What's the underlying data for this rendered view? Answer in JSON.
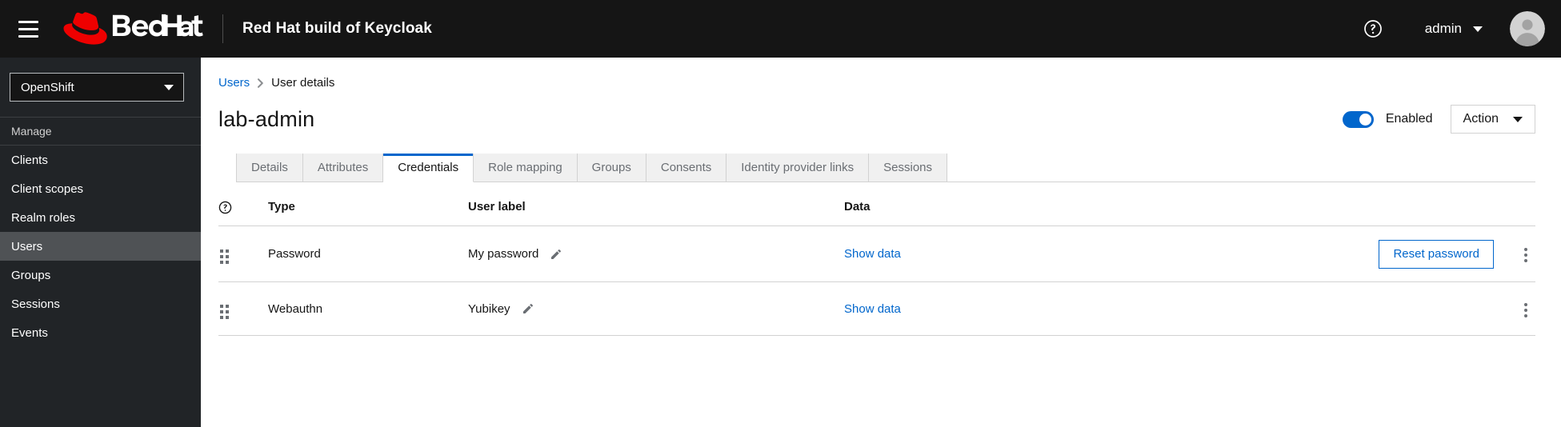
{
  "masthead": {
    "menu_toggle_name": "Global navigation",
    "brand_text": "Red Hat",
    "product_title": "Red Hat build of Keycloak",
    "help_icon": "help-circle-icon",
    "username": "admin",
    "avatar_icon": "user-avatar-icon"
  },
  "sidebar": {
    "realm": {
      "selected": "OpenShift",
      "caret_icon": "chevron-down-icon"
    },
    "section_title": "Manage",
    "items": [
      {
        "label": "Clients",
        "selected": false
      },
      {
        "label": "Client scopes",
        "selected": false
      },
      {
        "label": "Realm roles",
        "selected": false
      },
      {
        "label": "Users",
        "selected": true
      },
      {
        "label": "Groups",
        "selected": false
      },
      {
        "label": "Sessions",
        "selected": false
      },
      {
        "label": "Events",
        "selected": false
      }
    ]
  },
  "breadcrumb": {
    "parent": "Users",
    "separator_icon": "chevron-right-icon",
    "current": "User details"
  },
  "page": {
    "title": "lab-admin",
    "enabled_toggle": {
      "label": "Enabled",
      "on": true
    },
    "action_button": {
      "label": "Action",
      "caret_icon": "chevron-down-icon"
    }
  },
  "tabs": [
    {
      "label": "Details",
      "active": false
    },
    {
      "label": "Attributes",
      "active": false
    },
    {
      "label": "Credentials",
      "active": true
    },
    {
      "label": "Role mapping",
      "active": false
    },
    {
      "label": "Groups",
      "active": false
    },
    {
      "label": "Consents",
      "active": false
    },
    {
      "label": "Identity provider links",
      "active": false
    },
    {
      "label": "Sessions",
      "active": false
    }
  ],
  "credentials_table": {
    "columns": {
      "help_icon": "help-circle-icon",
      "type": "Type",
      "user_label": "User label",
      "data": "Data"
    },
    "rows": [
      {
        "drag_handle_icon": "drag-handle-icon",
        "type": "Password",
        "user_label": "My password",
        "edit_icon": "pencil-icon",
        "data_link": "Show data",
        "action_label": "Reset password",
        "has_action_button": true,
        "kebab_icon": "kebab-menu-icon"
      },
      {
        "drag_handle_icon": "drag-handle-icon",
        "type": "Webauthn",
        "user_label": "Yubikey",
        "edit_icon": "pencil-icon",
        "data_link": "Show data",
        "action_label": "",
        "has_action_button": false,
        "kebab_icon": "kebab-menu-icon"
      }
    ]
  },
  "colors": {
    "accent_blue": "#0066cc",
    "masthead_bg": "#151515",
    "sidebar_bg": "#212427",
    "sidebar_selected_bg": "#4f5255",
    "brand_red": "#ee0000",
    "tab_inactive_bg": "#f0f0f0",
    "border": "#d2d2d2"
  }
}
